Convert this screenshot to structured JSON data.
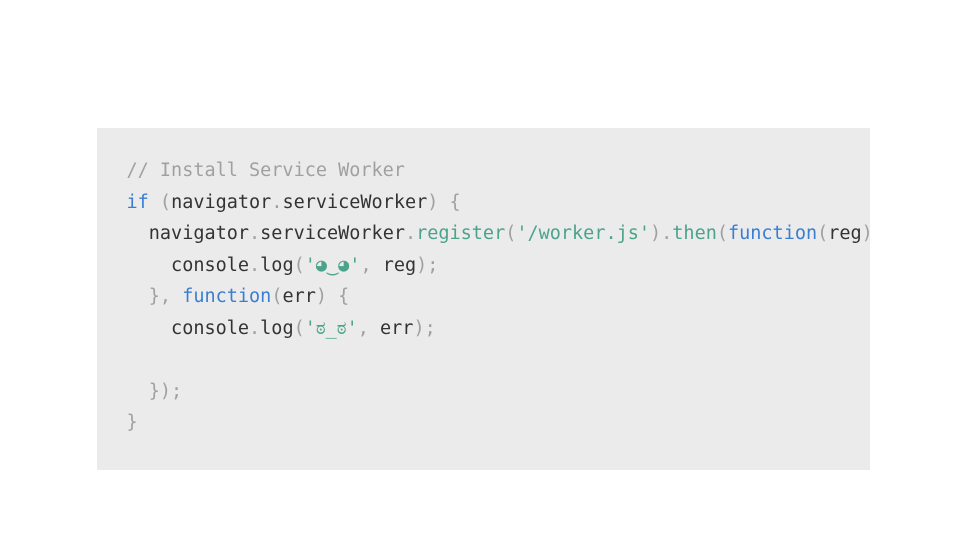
{
  "code": {
    "tokens": [
      {
        "t": "// Install Service Worker",
        "c": "comment"
      },
      {
        "t": "\n",
        "c": "plain"
      },
      {
        "t": "if",
        "c": "keyword"
      },
      {
        "t": " ",
        "c": "plain"
      },
      {
        "t": "(",
        "c": "punct"
      },
      {
        "t": "navigator",
        "c": "plain"
      },
      {
        "t": ".",
        "c": "punct"
      },
      {
        "t": "serviceWorker",
        "c": "plain"
      },
      {
        "t": ")",
        "c": "punct"
      },
      {
        "t": " ",
        "c": "plain"
      },
      {
        "t": "{",
        "c": "punct"
      },
      {
        "t": "\n",
        "c": "plain"
      },
      {
        "t": "  navigator",
        "c": "plain"
      },
      {
        "t": ".",
        "c": "punct"
      },
      {
        "t": "serviceWorker",
        "c": "plain"
      },
      {
        "t": ".",
        "c": "punct"
      },
      {
        "t": "register",
        "c": "method"
      },
      {
        "t": "(",
        "c": "punct"
      },
      {
        "t": "'/worker.js'",
        "c": "string"
      },
      {
        "t": ")",
        "c": "punct"
      },
      {
        "t": ".",
        "c": "punct"
      },
      {
        "t": "then",
        "c": "method"
      },
      {
        "t": "(",
        "c": "punct"
      },
      {
        "t": "function",
        "c": "keyword"
      },
      {
        "t": "(",
        "c": "punct"
      },
      {
        "t": "reg",
        "c": "plain"
      },
      {
        "t": ")",
        "c": "punct"
      },
      {
        "t": " ",
        "c": "plain"
      },
      {
        "t": "{",
        "c": "punct"
      },
      {
        "t": "\n",
        "c": "plain"
      },
      {
        "t": "    console",
        "c": "plain"
      },
      {
        "t": ".",
        "c": "punct"
      },
      {
        "t": "log",
        "c": "plain"
      },
      {
        "t": "(",
        "c": "punct"
      },
      {
        "t": "'◕‿◕'",
        "c": "string"
      },
      {
        "t": ",",
        "c": "punct"
      },
      {
        "t": " reg",
        "c": "plain"
      },
      {
        "t": ");",
        "c": "punct"
      },
      {
        "t": "\n",
        "c": "plain"
      },
      {
        "t": "  ",
        "c": "plain"
      },
      {
        "t": "}",
        "c": "punct"
      },
      {
        "t": ",",
        "c": "punct"
      },
      {
        "t": " ",
        "c": "plain"
      },
      {
        "t": "function",
        "c": "keyword"
      },
      {
        "t": "(",
        "c": "punct"
      },
      {
        "t": "err",
        "c": "plain"
      },
      {
        "t": ")",
        "c": "punct"
      },
      {
        "t": " ",
        "c": "plain"
      },
      {
        "t": "{",
        "c": "punct"
      },
      {
        "t": "\n",
        "c": "plain"
      },
      {
        "t": "    console",
        "c": "plain"
      },
      {
        "t": ".",
        "c": "punct"
      },
      {
        "t": "log",
        "c": "plain"
      },
      {
        "t": "(",
        "c": "punct"
      },
      {
        "t": "'ಠ_ಠ'",
        "c": "string"
      },
      {
        "t": ",",
        "c": "punct"
      },
      {
        "t": " err",
        "c": "plain"
      },
      {
        "t": ");",
        "c": "punct"
      },
      {
        "t": "\n",
        "c": "plain"
      },
      {
        "t": "\n",
        "c": "plain"
      },
      {
        "t": "  ",
        "c": "plain"
      },
      {
        "t": "});",
        "c": "punct"
      },
      {
        "t": "\n",
        "c": "plain"
      },
      {
        "t": "}",
        "c": "punct"
      }
    ]
  }
}
